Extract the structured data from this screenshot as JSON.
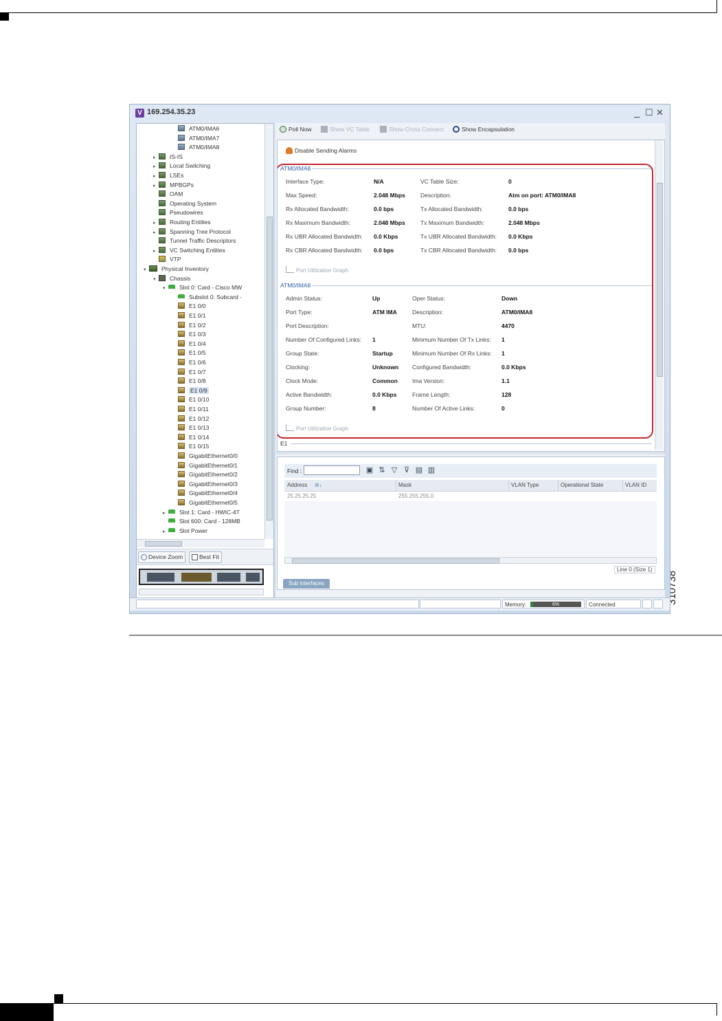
{
  "figure": {
    "id": "310738"
  },
  "window": {
    "title": "169.254.35.23",
    "controls": {
      "minimize": "_",
      "maximize": "☐",
      "close": "✕"
    }
  },
  "tree": {
    "items": [
      {
        "label": "ATM0/IMA6",
        "icon": "ima-group-icon"
      },
      {
        "label": "ATM0/IMA7",
        "icon": "ima-group-icon"
      },
      {
        "label": "ATM0/IMA8",
        "icon": "ima-group-icon"
      },
      {
        "label": "IS-IS",
        "icon": "module-icon",
        "expandable": true
      },
      {
        "label": "Local Switching",
        "icon": "module-icon",
        "expandable": true
      },
      {
        "label": "LSEs",
        "icon": "module-icon",
        "expandable": true
      },
      {
        "label": "MPBGPs",
        "icon": "module-icon",
        "expandable": true
      },
      {
        "label": "OAM",
        "icon": "module-icon"
      },
      {
        "label": "Operating System",
        "icon": "module-icon"
      },
      {
        "label": "Pseudowires",
        "icon": "module-icon"
      },
      {
        "label": "Routing Entities",
        "icon": "module-icon",
        "expandable": true
      },
      {
        "label": "Spanning Tree Protocol",
        "icon": "module-icon",
        "expandable": true
      },
      {
        "label": "Tunnel Traffic Descriptors",
        "icon": "module-icon"
      },
      {
        "label": "VC Switching Entities",
        "icon": "module-icon",
        "expandable": true
      },
      {
        "label": "VTP",
        "icon": "vtp-icon"
      },
      {
        "label": "Physical Inventory",
        "icon": "physical-inventory-icon",
        "expanded": true
      },
      {
        "label": "Chassis",
        "icon": "chassis-icon",
        "expanded": true
      },
      {
        "label": "Slot 0: Card - Cisco MW",
        "icon": "card-icon",
        "expanded": true
      },
      {
        "label": "Subslot 0: Subcard -",
        "icon": "card-icon"
      },
      {
        "label": "E1 0/0",
        "icon": "port-icon"
      },
      {
        "label": "E1 0/1",
        "icon": "port-icon"
      },
      {
        "label": "E1 0/2",
        "icon": "port-icon"
      },
      {
        "label": "E1 0/3",
        "icon": "port-icon"
      },
      {
        "label": "E1 0/4",
        "icon": "port-icon"
      },
      {
        "label": "E1 0/5",
        "icon": "port-icon"
      },
      {
        "label": "E1 0/6",
        "icon": "port-icon"
      },
      {
        "label": "E1 0/7",
        "icon": "port-icon"
      },
      {
        "label": "E1 0/8",
        "icon": "port-icon"
      },
      {
        "label": "E1 0/9",
        "icon": "port-icon",
        "selected": true
      },
      {
        "label": "E1 0/10",
        "icon": "port-icon"
      },
      {
        "label": "E1 0/11",
        "icon": "port-icon"
      },
      {
        "label": "E1 0/12",
        "icon": "port-icon"
      },
      {
        "label": "E1 0/13",
        "icon": "port-icon"
      },
      {
        "label": "E1 0/14",
        "icon": "port-icon"
      },
      {
        "label": "E1 0/15",
        "icon": "port-icon"
      },
      {
        "label": "GigabitEthernet0/0",
        "icon": "port-icon"
      },
      {
        "label": "GigabitEthernet0/1",
        "icon": "port-icon"
      },
      {
        "label": "GigabitEthernet0/2",
        "icon": "port-icon"
      },
      {
        "label": "GigabitEthernet0/3",
        "icon": "port-icon"
      },
      {
        "label": "GigabitEthernet0/4",
        "icon": "port-icon"
      },
      {
        "label": "GigabitEthernet0/5",
        "icon": "port-icon"
      },
      {
        "label": "Slot 1: Card - HWIC-4T",
        "icon": "card-icon",
        "expandable": true
      },
      {
        "label": "Slot 600: Card - 128MB",
        "icon": "card-icon"
      },
      {
        "label": "Slot Power",
        "icon": "card-icon",
        "expandable": true
      }
    ]
  },
  "zoom": {
    "device_zoom": "Device Zoom",
    "best_fit": "Best Fit"
  },
  "toolbar": {
    "poll_now": "Poll Now",
    "show_vc_table": "Show VC Table",
    "show_cross_connect": "Show Cross Connect",
    "show_encapsulation": "Show Encapsulation"
  },
  "details": {
    "disable_alarms": "Disable Sending Alarms",
    "atm_section": {
      "title": "ATM0/IMA8",
      "left": [
        {
          "label": "Interface Type:",
          "value": "N/A"
        },
        {
          "label": "Max Speed:",
          "value": "2.048 Mbps"
        },
        {
          "label": "Rx Allocated Bandwidth:",
          "value": "0.0 bps"
        },
        {
          "label": "Rx Maximum Bandwidth:",
          "value": "2.048 Mbps"
        },
        {
          "label": "Rx UBR Allocated Bandwidth:",
          "value": "0.0 Kbps"
        },
        {
          "label": "Rx CBR Allocated Bandwidth:",
          "value": "0.0 bps"
        }
      ],
      "right": [
        {
          "label": "VC Table Size:",
          "value": "0"
        },
        {
          "label": "Description:",
          "value": "Atm on port: ATM0/IMA8"
        },
        {
          "label": "Tx Allocated Bandwidth:",
          "value": "0.0 bps"
        },
        {
          "label": "Tx Maximum Bandwidth:",
          "value": "2.048 Mbps"
        },
        {
          "label": "Tx UBR Allocated Bandwidth:",
          "value": "0.0 Kbps"
        },
        {
          "label": "Tx CBR Allocated Bandwidth:",
          "value": "0.0 bps"
        }
      ],
      "graph_link": "Port Utilization Graph"
    },
    "ima_section": {
      "title": "ATM0/IMA8",
      "left": [
        {
          "label": "Admin Status:",
          "value": "Up"
        },
        {
          "label": "Port Type:",
          "value": "ATM IMA"
        },
        {
          "label": "Port Description:",
          "value": ""
        },
        {
          "label": "Number Of Configured Links:",
          "value": "1"
        },
        {
          "label": "Group State:",
          "value": "Startup"
        },
        {
          "label": "Clocking:",
          "value": "Unknown"
        },
        {
          "label": "Clock Mode:",
          "value": "Common"
        },
        {
          "label": "Active Bandwidth:",
          "value": "0.0 Kbps"
        },
        {
          "label": "Group Number:",
          "value": "8"
        }
      ],
      "right": [
        {
          "label": "Oper Status:",
          "value": "Down"
        },
        {
          "label": "Description:",
          "value": "ATM0/IMA8"
        },
        {
          "label": "MTU:",
          "value": "4470"
        },
        {
          "label": "Minimum Number Of Tx Links:",
          "value": "1"
        },
        {
          "label": "Minimum Number Of Rx Links:",
          "value": "1"
        },
        {
          "label": "Configured Bandwidth:",
          "value": "0.0 Kbps"
        },
        {
          "label": "Ima Version:",
          "value": "1.1"
        },
        {
          "label": "Frame Length:",
          "value": "128"
        },
        {
          "label": "Number Of Active Links:",
          "value": "0"
        }
      ],
      "graph_link": "Port Utilization Graph"
    },
    "e1_section": {
      "title": "E1"
    }
  },
  "sub_interfaces": {
    "find_label": "Find :",
    "find_value": "",
    "columns": [
      "Address",
      "Mask",
      "VLAN Type",
      "Operational State",
      "VLAN ID"
    ],
    "rows": [
      [
        "25.25.25.25",
        "255.255.255.0",
        "",
        "",
        ""
      ]
    ],
    "line_status": "Line 0 (Size 1)",
    "tab_label": "Sub Interfaces"
  },
  "status": {
    "memory_label": "Memory:",
    "memory_percent": 6,
    "memory_text": "6%",
    "connection": "Connected"
  }
}
